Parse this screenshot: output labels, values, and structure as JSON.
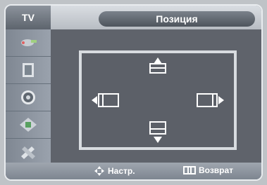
{
  "header": {
    "tv_label": "TV",
    "title": "Позиция"
  },
  "sidebar": {
    "items": [
      {
        "icon": "picture-input-icon"
      },
      {
        "icon": "tv-screen-icon"
      },
      {
        "icon": "speaker-icon"
      },
      {
        "icon": "chip-setup-icon"
      },
      {
        "icon": "tools-icon"
      }
    ]
  },
  "position_panel": {
    "arrows": [
      "up",
      "left",
      "right",
      "down"
    ]
  },
  "footer": {
    "adjust_label": "Настр.",
    "back_label": "Возврат"
  }
}
